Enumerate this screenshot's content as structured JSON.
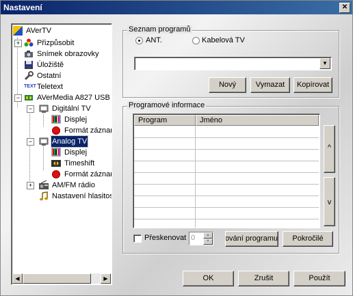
{
  "window": {
    "title": "Nastavení",
    "close": "✕"
  },
  "tree": {
    "items": [
      {
        "label": "AVerTV"
      },
      {
        "label": "Přizpůsobit"
      },
      {
        "label": "Snímek obrazovky"
      },
      {
        "label": "Úložiště"
      },
      {
        "label": "Ostatní"
      },
      {
        "label": "Teletext"
      },
      {
        "label": "AVerMedia A827 USB"
      },
      {
        "label": "Digitální TV"
      },
      {
        "label": "Displej"
      },
      {
        "label": "Formát záznamu"
      },
      {
        "label": "Analog TV"
      },
      {
        "label": "Displej"
      },
      {
        "label": "Timeshift"
      },
      {
        "label": "Formát záznamu"
      },
      {
        "label": "AM/FM rádio"
      },
      {
        "label": "Nastavení hlasitosti"
      }
    ],
    "selected_index": 10
  },
  "program_list": {
    "title": "Seznam programů",
    "radio_ant": "ANT.",
    "radio_cable": "Kabelová TV",
    "selected": "ANT.",
    "combo_value": "",
    "buttons": {
      "new": "Nový",
      "delete": "Vymazat",
      "copy": "Kopírovat"
    }
  },
  "program_info": {
    "title": "Programové informace",
    "columns": [
      "Program",
      "Jméno"
    ],
    "rows": [],
    "scroll_up": "^",
    "scroll_down": "v",
    "rescan_label": "Přeskenovat",
    "rescan_checked": false,
    "rescan_value": "0",
    "rename_button": "Přejmenování programu",
    "advanced_button": "Pokročilé"
  },
  "footer": {
    "ok": "OK",
    "cancel": "Zrušit",
    "apply": "Použít"
  },
  "colors": {
    "title_bar": "#0a246a",
    "selection": "#0a246a"
  }
}
